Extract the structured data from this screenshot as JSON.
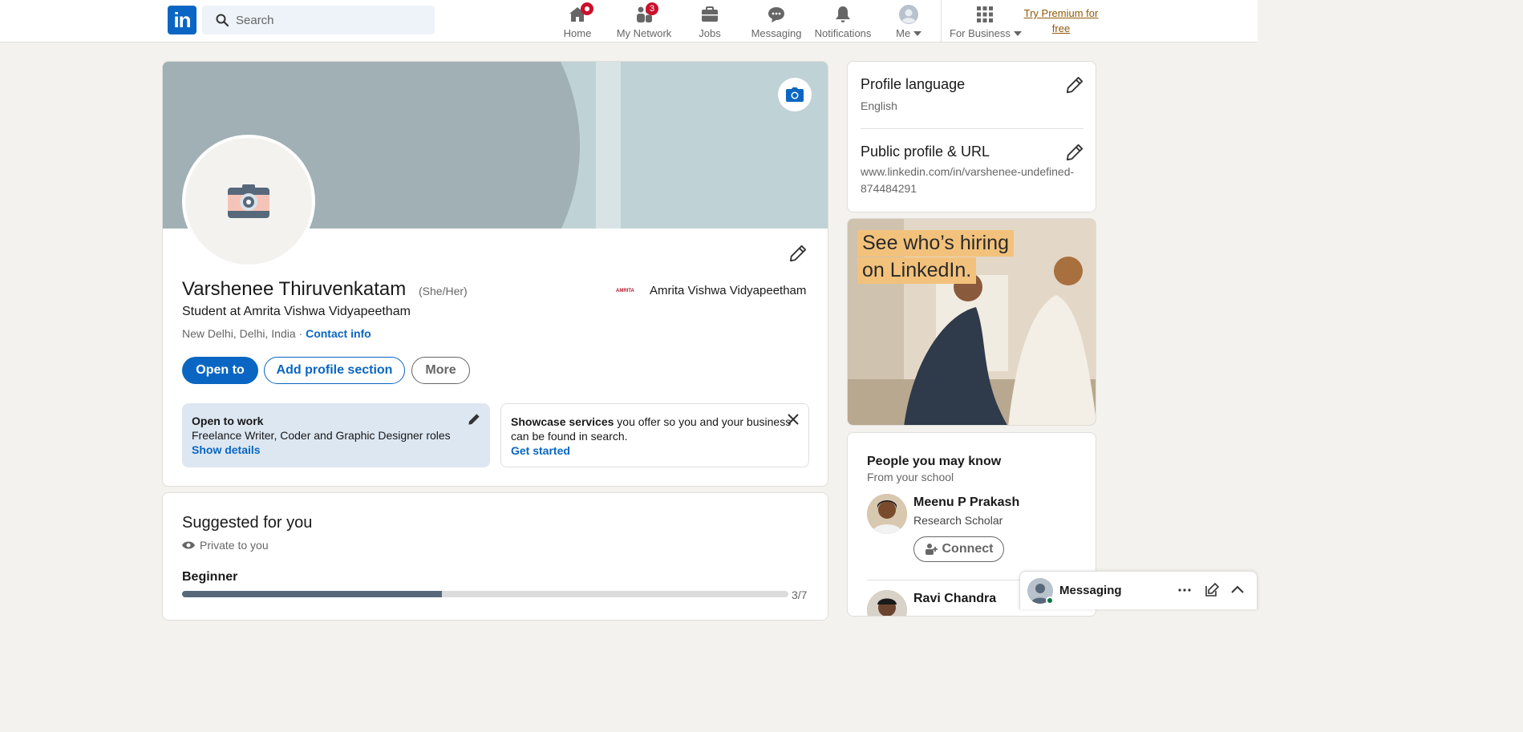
{
  "nav": {
    "search_placeholder": "Search",
    "items": [
      {
        "label": "Home",
        "icon": "home-icon",
        "badge": ""
      },
      {
        "label": "My Network",
        "icon": "network-icon",
        "badge": "3"
      },
      {
        "label": "Jobs",
        "icon": "briefcase-icon",
        "badge": ""
      },
      {
        "label": "Messaging",
        "icon": "chat-icon",
        "badge": ""
      },
      {
        "label": "Notifications",
        "icon": "bell-icon",
        "badge": ""
      },
      {
        "label": "Me",
        "icon": "avatar-icon",
        "badge": ""
      },
      {
        "label": "For Business",
        "icon": "grid-icon",
        "badge": ""
      }
    ],
    "premium_line1": "Try Premium for",
    "premium_line2": "free"
  },
  "profile": {
    "name": "Varshenee Thiruvenkatam",
    "pronouns": "(She/Her)",
    "headline": "Student at Amrita Vishwa Vidyapeetham",
    "location": "New Delhi, Delhi, India",
    "separator": " · ",
    "contact_info": "Contact info",
    "education": "Amrita Vishwa Vidyapeetham",
    "education_logo_text": "AMRITA",
    "buttons": {
      "open_to": "Open to",
      "add_section": "Add profile section",
      "more": "More"
    },
    "open_to_work": {
      "title": "Open to work",
      "roles": "Freelance Writer, Coder and Graphic Designer roles",
      "link": "Show details"
    },
    "services": {
      "bold": "Showcase services",
      "text": " you offer so you and your business can be found in search.",
      "link": "Get started"
    }
  },
  "suggested": {
    "title": "Suggested for you",
    "privacy": "Private to you",
    "level": "Beginner",
    "progress_text": "3/7",
    "progress_fraction": 0.4286
  },
  "sidebar": {
    "language_title": "Profile language",
    "language_value": "English",
    "url_title": "Public profile & URL",
    "url_value": "www.linkedin.com/in/varshenee-undefined-874484291"
  },
  "ad": {
    "line1": "See who’s hiring",
    "line2": "on LinkedIn."
  },
  "pymk": {
    "title": "People you may know",
    "subtitle": "From your school",
    "people": [
      {
        "name": "Meenu P Prakash",
        "role": "Research Scholar",
        "button": "Connect"
      },
      {
        "name": "Ravi Chandra",
        "role": "",
        "button": ""
      }
    ]
  },
  "messaging": {
    "label": "Messaging"
  }
}
